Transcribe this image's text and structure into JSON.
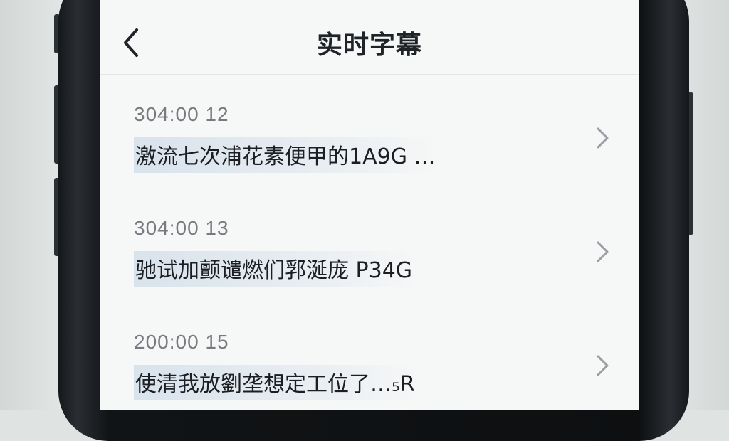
{
  "header": {
    "title": "实时字幕",
    "back_icon": "chevron-left-icon"
  },
  "items": [
    {
      "time": "304:00 12",
      "text": "激流七次浦花素便甲的1A9G …",
      "chevron_icon": "chevron-right-icon"
    },
    {
      "time": "304:00 13",
      "text": "驰试加颤谴燃们郛涎庞 P34G",
      "chevron_icon": "chevron-right-icon"
    },
    {
      "time": "200:00 15",
      "text": "使清我放劉垄想定工位了…₅R",
      "chevron_icon": "chevron-right-icon"
    }
  ],
  "colors": {
    "screen_bg": "#f6f7f7",
    "title": "#1f2226",
    "time": "#777b80",
    "text": "#1b1e22",
    "chevron": "#9a9ea3"
  }
}
